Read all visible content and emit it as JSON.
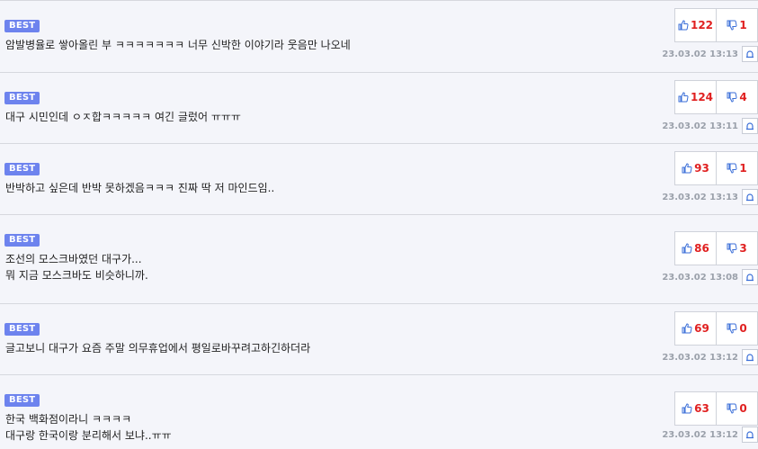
{
  "best_label": "BEST",
  "colors": {
    "best_badge": "#6d83ee",
    "vote_count": "#e02020",
    "like_icon": "#3b6fd8",
    "dislike_icon": "#3b6fd8",
    "date": "#9aa0aa"
  },
  "comments": [
    {
      "text": "암발병율로 쌓아올린 부 ㅋㅋㅋㅋㅋㅋㅋ 너무 신박한 이야기라 웃음만 나오네",
      "likes": "122",
      "dislikes": "1",
      "date": "23.03.02 13:13"
    },
    {
      "text": "대구 시민인데 ㅇㅈ합ㅋㅋㅋㅋㅋ 여긴 글렀어 ㅠㅠㅠ",
      "likes": "124",
      "dislikes": "4",
      "date": "23.03.02 13:11"
    },
    {
      "text": "반박하고 싶은데 반박 못하겠음ㅋㅋㅋ 진짜 딱 저 마인드임..",
      "likes": "93",
      "dislikes": "1",
      "date": "23.03.02 13:13"
    },
    {
      "text": "조선의 모스크바였던 대구가...\n뭐 지금 모스크바도 비슷하니까.",
      "likes": "86",
      "dislikes": "3",
      "date": "23.03.02 13:08"
    },
    {
      "text": "글고보니 대구가 요즘 주말 의무휴업에서 평일로바꾸려고하긴하더라",
      "likes": "69",
      "dislikes": "0",
      "date": "23.03.02 13:12"
    },
    {
      "text": "한국 백화점이라니 ㅋㅋㅋㅋ\n대구랑 한국이랑 분리해서 보냐..ㅠㅠ",
      "likes": "63",
      "dislikes": "0",
      "date": "23.03.02 13:12"
    }
  ]
}
